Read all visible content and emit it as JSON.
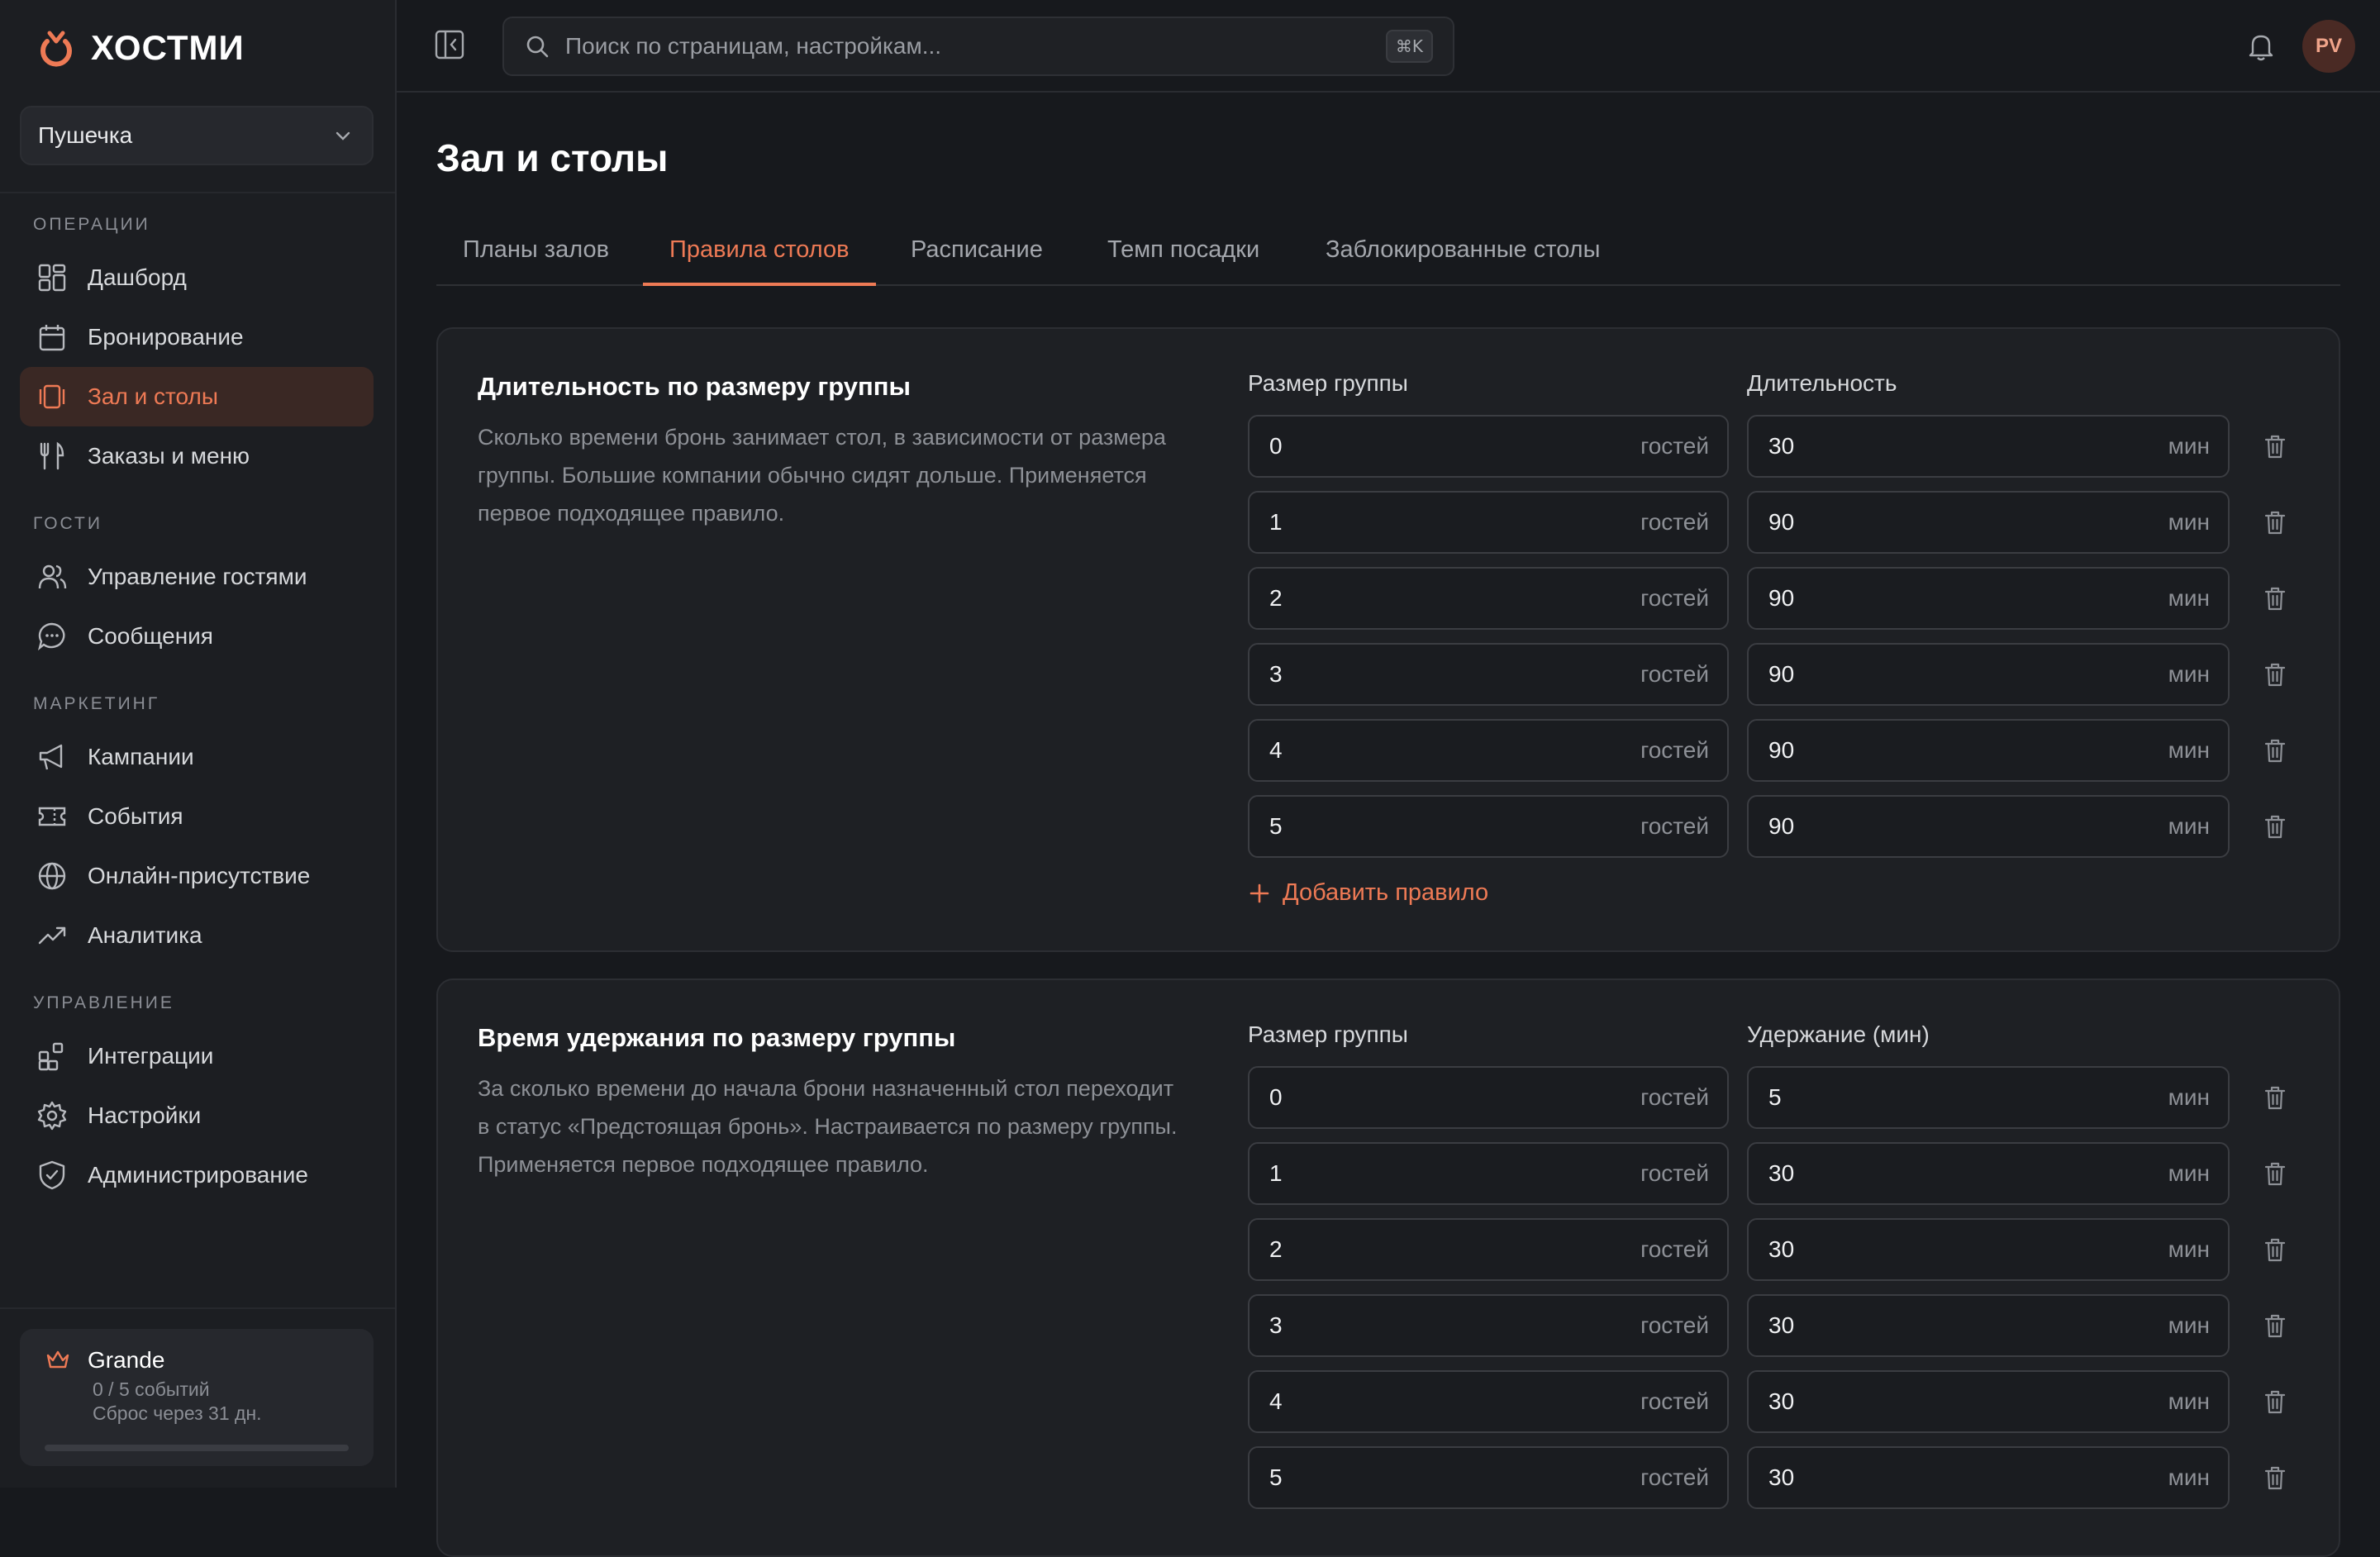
{
  "app": {
    "logo_text": "ХОСТМИ",
    "venue": "Пушечка",
    "accent": "#ee7a55"
  },
  "sidebar": {
    "sections": [
      {
        "label": "ОПЕРАЦИИ",
        "items": [
          {
            "label": "Дашборд",
            "icon": "dashboard-icon"
          },
          {
            "label": "Бронирование",
            "icon": "calendar-icon"
          },
          {
            "label": "Зал и столы",
            "icon": "tables-icon",
            "active": true
          },
          {
            "label": "Заказы и меню",
            "icon": "utensils-icon"
          }
        ]
      },
      {
        "label": "ГОСТИ",
        "items": [
          {
            "label": "Управление гостями",
            "icon": "users-icon"
          },
          {
            "label": "Сообщения",
            "icon": "message-icon"
          }
        ]
      },
      {
        "label": "МАРКЕТИНГ",
        "items": [
          {
            "label": "Кампании",
            "icon": "megaphone-icon"
          },
          {
            "label": "События",
            "icon": "ticket-icon"
          },
          {
            "label": "Онлайн-присутствие",
            "icon": "globe-icon"
          },
          {
            "label": "Аналитика",
            "icon": "trend-icon"
          }
        ]
      },
      {
        "label": "УПРАВЛЕНИЕ",
        "items": [
          {
            "label": "Интеграции",
            "icon": "integrations-icon"
          },
          {
            "label": "Настройки",
            "icon": "gear-icon"
          },
          {
            "label": "Администрирование",
            "icon": "shield-icon"
          }
        ]
      }
    ],
    "plan": {
      "name": "Grande",
      "usage": "0 / 5 событий",
      "reset": "Сброс через 31 дн.",
      "progress": 0.0
    }
  },
  "topbar": {
    "search_placeholder": "Поиск по страницам, настройкам...",
    "shortcut": "⌘K",
    "avatar_initials": "PV"
  },
  "main": {
    "title": "Зал и столы",
    "tabs": [
      "Планы залов",
      "Правила столов",
      "Расписание",
      "Темп посадки",
      "Заблокированные столы"
    ],
    "active_tab": 1,
    "duration_card": {
      "title": "Длительность по размеру группы",
      "description": "Сколько времени бронь занимает стол, в зависимости от размера группы. Большие компании обычно сидят дольше. Применяется первое подходящее правило.",
      "col_size": "Размер группы",
      "col_value": "Длительность",
      "size_unit": "гостей",
      "value_unit": "мин",
      "rules": [
        {
          "size": "0",
          "value": "30"
        },
        {
          "size": "1",
          "value": "90"
        },
        {
          "size": "2",
          "value": "90"
        },
        {
          "size": "3",
          "value": "90"
        },
        {
          "size": "4",
          "value": "90"
        },
        {
          "size": "5",
          "value": "90"
        }
      ],
      "add_label": "Добавить правило"
    },
    "hold_card": {
      "title": "Время удержания по размеру группы",
      "description": "За сколько времени до начала брони назначенный стол переходит в статус «Предстоящая бронь». Настраивается по размеру группы. Применяется первое подходящее правило.",
      "col_size": "Размер группы",
      "col_value": "Удержание (мин)",
      "size_unit": "гостей",
      "value_unit": "мин",
      "rules": [
        {
          "size": "0",
          "value": "5"
        },
        {
          "size": "1",
          "value": "30"
        },
        {
          "size": "2",
          "value": "30"
        },
        {
          "size": "3",
          "value": "30"
        },
        {
          "size": "4",
          "value": "30"
        },
        {
          "size": "5",
          "value": "30"
        }
      ]
    }
  }
}
